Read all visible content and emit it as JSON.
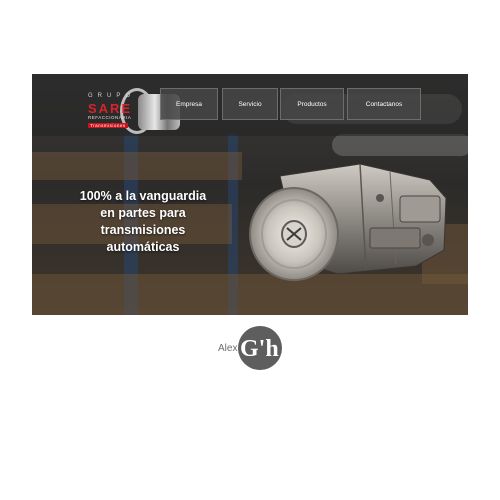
{
  "brand": {
    "top_text": "GRUPO",
    "name": "SARE",
    "subtitle": "REFACCIONARIA",
    "tagline": "Transmisiones",
    "accent_color": "#d8232a"
  },
  "nav": {
    "items": [
      {
        "label": "Empresa"
      },
      {
        "label": "Servicio"
      },
      {
        "label": "Productos"
      },
      {
        "label": "Contactanos"
      }
    ]
  },
  "hero": {
    "lines": [
      "100% a la vanguardia",
      "en partes para",
      "transmisiones",
      "automáticas"
    ],
    "image": "automatic-transmission-image"
  },
  "footer": {
    "signature_text": "Alex",
    "signature_mark": "G'h"
  }
}
